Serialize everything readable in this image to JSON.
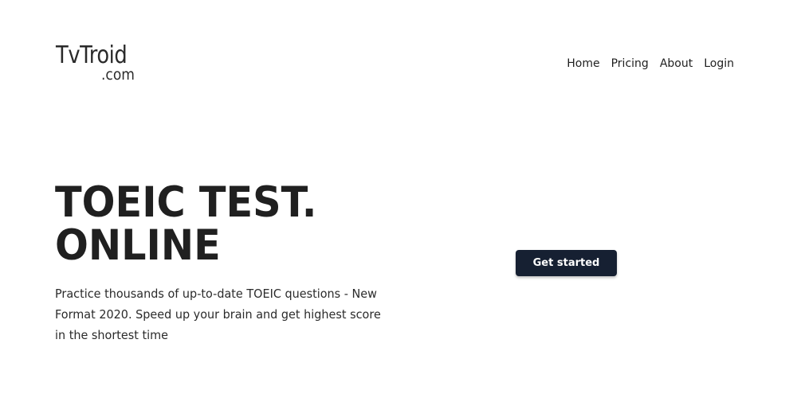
{
  "logo": {
    "main": "TvTroid",
    "sub": ".com"
  },
  "nav": {
    "items": [
      {
        "label": "Home"
      },
      {
        "label": "Pricing"
      },
      {
        "label": "About"
      },
      {
        "label": "Login"
      }
    ]
  },
  "hero": {
    "title_line1": "TOEIC TEST.",
    "title_line2": "ONLINE",
    "description": "Practice thousands of up-to-date TOEIC questions - New Format 2020. Speed up your brain and get highest score in the shortest time",
    "cta_label": "Get started"
  },
  "colors": {
    "cta_background": "#162032",
    "text": "#202020",
    "background": "#ffffff"
  }
}
